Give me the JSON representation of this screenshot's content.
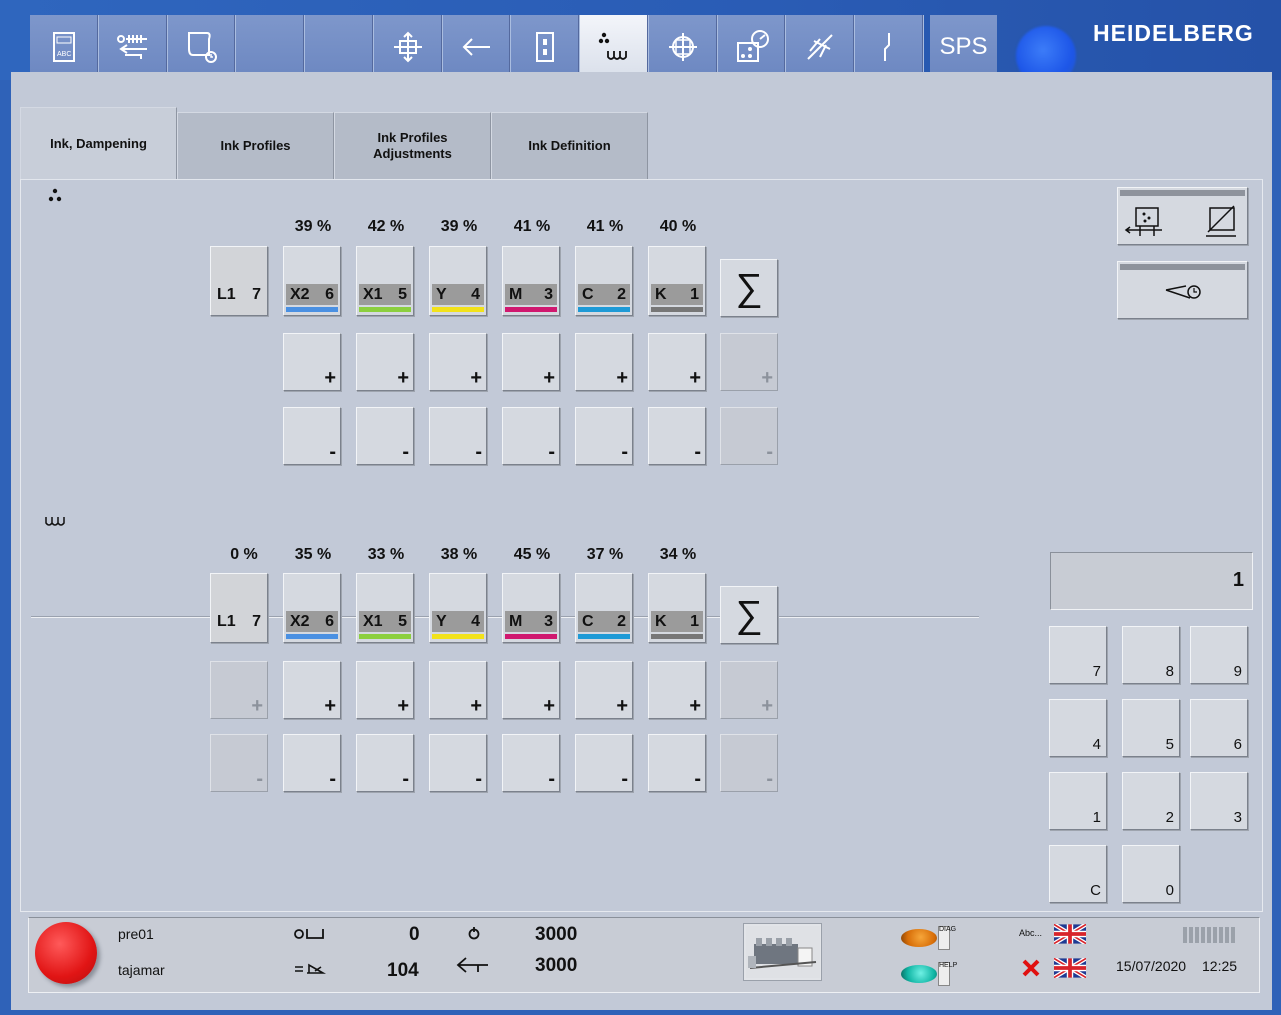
{
  "toolbar": {
    "items": [
      "ink-abc-icon",
      "delivery-transfer-icon",
      "job-scroll-icon",
      "empty-slot-1",
      "empty-slot-2",
      "register-icon",
      "feeder-arrow-icon",
      "door-icon",
      "ink-dampening-icon",
      "crosshair-icon",
      "press-settings-icon",
      "wash-icon",
      "cut-icon"
    ],
    "sps_label": "SPS"
  },
  "brand": "HEIDELBERG",
  "tabs": [
    {
      "label": "Ink, Dampening",
      "active": true
    },
    {
      "label": "Ink Profiles",
      "active": false
    },
    {
      "label": "Ink Profiles\nAdjustments",
      "active": false
    },
    {
      "label": "Ink Definition",
      "active": false
    }
  ],
  "ink": {
    "icon": "ink-dots-icon",
    "first_unit": {
      "letter": "L1",
      "num": "7"
    },
    "units": [
      {
        "pct": "39 %",
        "letter": "X2",
        "num": "6",
        "color": "#4a90e2"
      },
      {
        "pct": "42 %",
        "letter": "X1",
        "num": "5",
        "color": "#8ccf3e"
      },
      {
        "pct": "39 %",
        "letter": "Y",
        "num": "4",
        "color": "#f2e21a"
      },
      {
        "pct": "41 %",
        "letter": "M",
        "num": "3",
        "color": "#d0186f"
      },
      {
        "pct": "41 %",
        "letter": "C",
        "num": "2",
        "color": "#1e9ad6"
      },
      {
        "pct": "40 %",
        "letter": "K",
        "num": "1",
        "color": "#777777"
      }
    ],
    "sigma": "∑"
  },
  "dampening": {
    "icon": "dampening-wave-icon",
    "first_unit": {
      "pct": "0 %",
      "letter": "L1",
      "num": "7"
    },
    "units": [
      {
        "pct": "35 %",
        "letter": "X2",
        "num": "6",
        "color": "#4a90e2"
      },
      {
        "pct": "33 %",
        "letter": "X1",
        "num": "5",
        "color": "#8ccf3e"
      },
      {
        "pct": "38 %",
        "letter": "Y",
        "num": "4",
        "color": "#f2e21a"
      },
      {
        "pct": "45 %",
        "letter": "M",
        "num": "3",
        "color": "#d0186f"
      },
      {
        "pct": "37 %",
        "letter": "C",
        "num": "2",
        "color": "#1e9ad6"
      },
      {
        "pct": "34 %",
        "letter": "K",
        "num": "1",
        "color": "#777777"
      }
    ],
    "sigma": "∑"
  },
  "plus": "+",
  "minus": "-",
  "keypad": {
    "display": "1",
    "keys": [
      "7",
      "8",
      "9",
      "4",
      "5",
      "6",
      "1",
      "2",
      "3",
      "C",
      "0"
    ]
  },
  "status": {
    "user1": "pre01",
    "user2": "tajamar",
    "counter_a": "0",
    "counter_b": "104",
    "speed_a": "3000",
    "speed_b": "3000",
    "diag": "DIAG",
    "help": "HELP",
    "abc": "Abc...",
    "date": "15/07/2020",
    "time": "12:25"
  }
}
